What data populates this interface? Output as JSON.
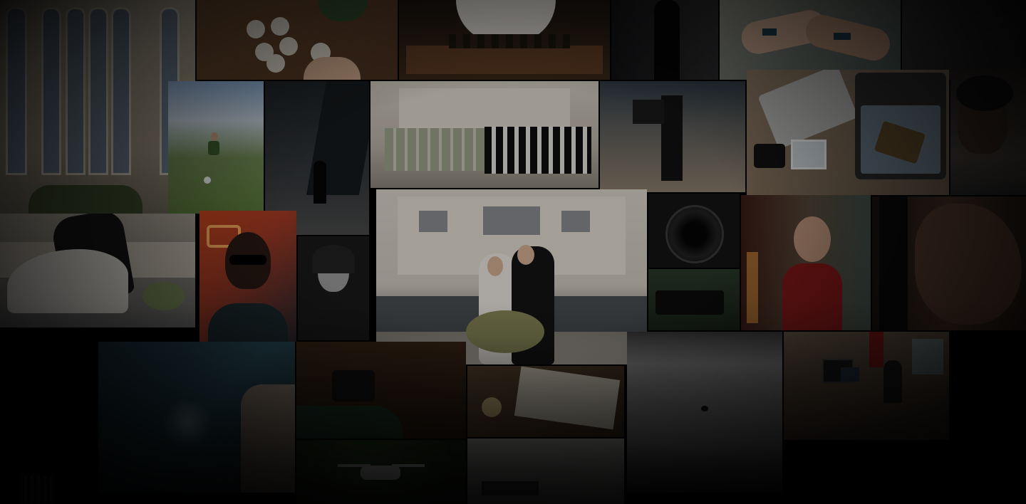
{
  "collage": {
    "tiles": [
      {
        "name": "photo-temple-windows",
        "color": "#a59c8a"
      },
      {
        "name": "photo-hands-painting-circles",
        "color": "#5a3c24"
      },
      {
        "name": "photo-chess-player",
        "color": "#2a1c14"
      },
      {
        "name": "photo-silhouette-doorway",
        "color": "#1b1b1d"
      },
      {
        "name": "photo-painted-hands",
        "color": "#5f6a62"
      },
      {
        "name": "photo-dark-corner-top-right",
        "color": "#2e2e2e"
      },
      {
        "name": "photo-boy-soccer",
        "color": "#5f7a48"
      },
      {
        "name": "photo-city-walkway-silhouette",
        "color": "#25282b"
      },
      {
        "name": "photo-wedding-party-temple",
        "color": "#a39e94"
      },
      {
        "name": "photo-camera-operator-legs",
        "color": "#6a6258"
      },
      {
        "name": "photo-laptop-suitcase-flatlay",
        "color": "#7d6f5f"
      },
      {
        "name": "photo-woman-in-water",
        "color": "#2c2623"
      },
      {
        "name": "photo-wedding-dip-kiss",
        "color": "#8d8a83"
      },
      {
        "name": "photo-neon-sunglasses-man",
        "color": "#8a4a2a"
      },
      {
        "name": "photo-woman-portrait-bw",
        "color": "#1a1a1a"
      },
      {
        "name": "photo-bride-groom-temple",
        "color": "#bdb6aa"
      },
      {
        "name": "photo-camera-lens-closeup",
        "color": "#141414"
      },
      {
        "name": "photo-cinema-camera-rig",
        "color": "#223022"
      },
      {
        "name": "photo-woman-red-top",
        "color": "#5a3a32"
      },
      {
        "name": "photo-face-closeup",
        "color": "#3a2a22"
      },
      {
        "name": "photo-cliff-jumpers-water",
        "color": "#1f3a44"
      },
      {
        "name": "photo-camera-in-hand",
        "color": "#3a2a1c"
      },
      {
        "name": "photo-map-compass",
        "color": "#5a4633"
      },
      {
        "name": "photo-misty-sky-bird",
        "color": "#6e6e6e"
      },
      {
        "name": "photo-editing-studio",
        "color": "#5e5246"
      },
      {
        "name": "photo-drone-over-forest",
        "color": "#22301d"
      },
      {
        "name": "photo-white-room-shelf",
        "color": "#9b9b98"
      },
      {
        "name": "photo-window-silhouette",
        "color": "#2d2d2d"
      }
    ]
  }
}
